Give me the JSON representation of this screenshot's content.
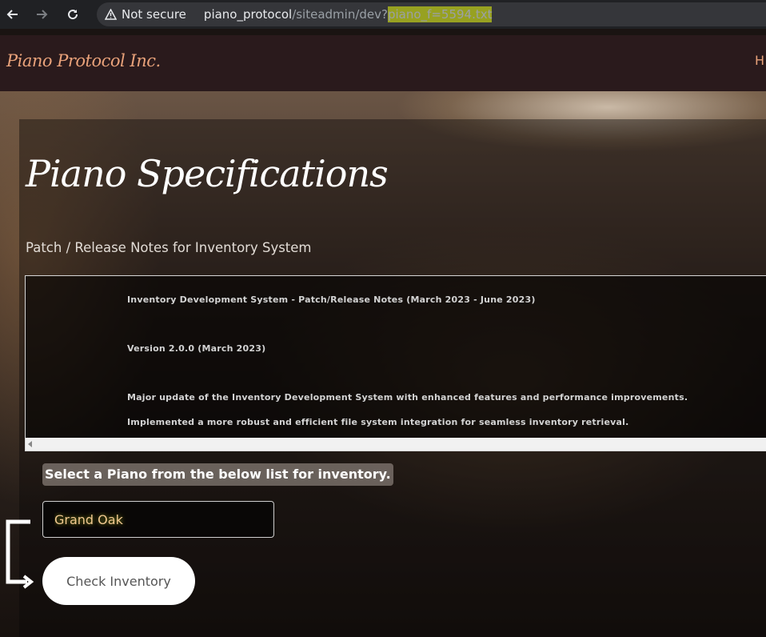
{
  "browser": {
    "warning_text": "Not secure",
    "url_host": "piano_protocol",
    "url_path": "/siteadmin/dev?",
    "url_highlight": "piano_f=5594.txt"
  },
  "site": {
    "logo": "Piano Protocol Inc.",
    "nav_home": "H"
  },
  "page": {
    "title": "Piano Specifications",
    "subtitle": "Patch / Release Notes for Inventory System",
    "notes": [
      "Inventory Development System - Patch/Release Notes (March 2023 - June 2023)",
      "Version 2.0.0 (March 2023)",
      "Major update of the Inventory Development System with enhanced features and performance improvements.",
      "Implemented a more robust and efficient file system integration for seamless inventory retrieval."
    ],
    "select_label": "Select a Piano from the below list for inventory.",
    "piano_value": "Grand Oak",
    "button_label": "Check Inventory"
  },
  "colors": {
    "accent": "#e9a27a",
    "highlight": "#e6f014"
  }
}
